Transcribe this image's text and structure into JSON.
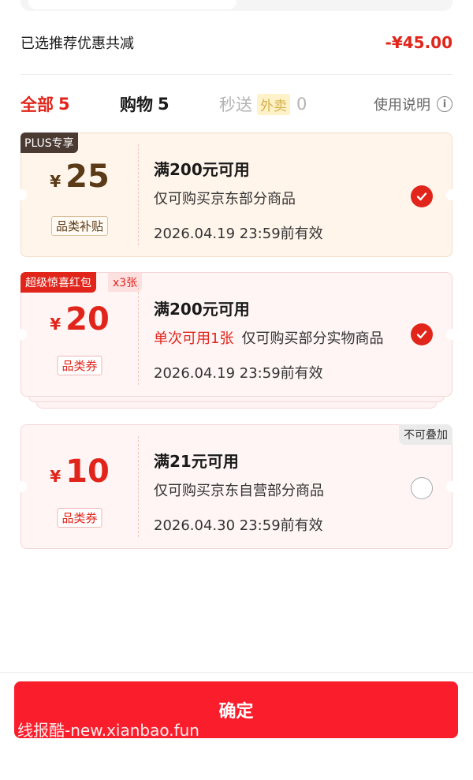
{
  "summary": {
    "label": "已选推荐优惠共减",
    "value": "-¥45.00"
  },
  "tabs": {
    "all": {
      "label": "全部",
      "count": "5"
    },
    "shopping": {
      "label": "购物",
      "count": "5"
    },
    "instant": {
      "label": "秒送",
      "tag": "外卖",
      "count": "0"
    },
    "help": "使用说明"
  },
  "coupons": [
    {
      "badge": "PLUS专享",
      "currency": "¥",
      "amount": "25",
      "category": "品类补贴",
      "condition": "满200元可用",
      "scope": "仅可购买京东部分商品",
      "expiry": "2026.04.19 23:59前有效",
      "selected": true
    },
    {
      "badge": "超级惊喜红包",
      "multiplier": "x3张",
      "currency": "¥",
      "amount": "20",
      "category": "品类券",
      "condition": "满200元可用",
      "highlight": "单次可用1张",
      "scope": "仅可购买部分实物商品",
      "expiry": "2026.04.19 23:59前有效",
      "selected": true
    },
    {
      "corner": "不可叠加",
      "currency": "¥",
      "amount": "10",
      "category": "品类券",
      "condition": "满21元可用",
      "scope": "仅可购买京东自营部分商品",
      "expiry": "2026.04.30 23:59前有效",
      "selected": false
    }
  ],
  "confirm_label": "确定",
  "watermark": "线报酷-new.xianbao.fun",
  "colors": {
    "accent": "#e1251b",
    "button": "#fa1d2c",
    "plus_badge": "#4a3a32"
  }
}
